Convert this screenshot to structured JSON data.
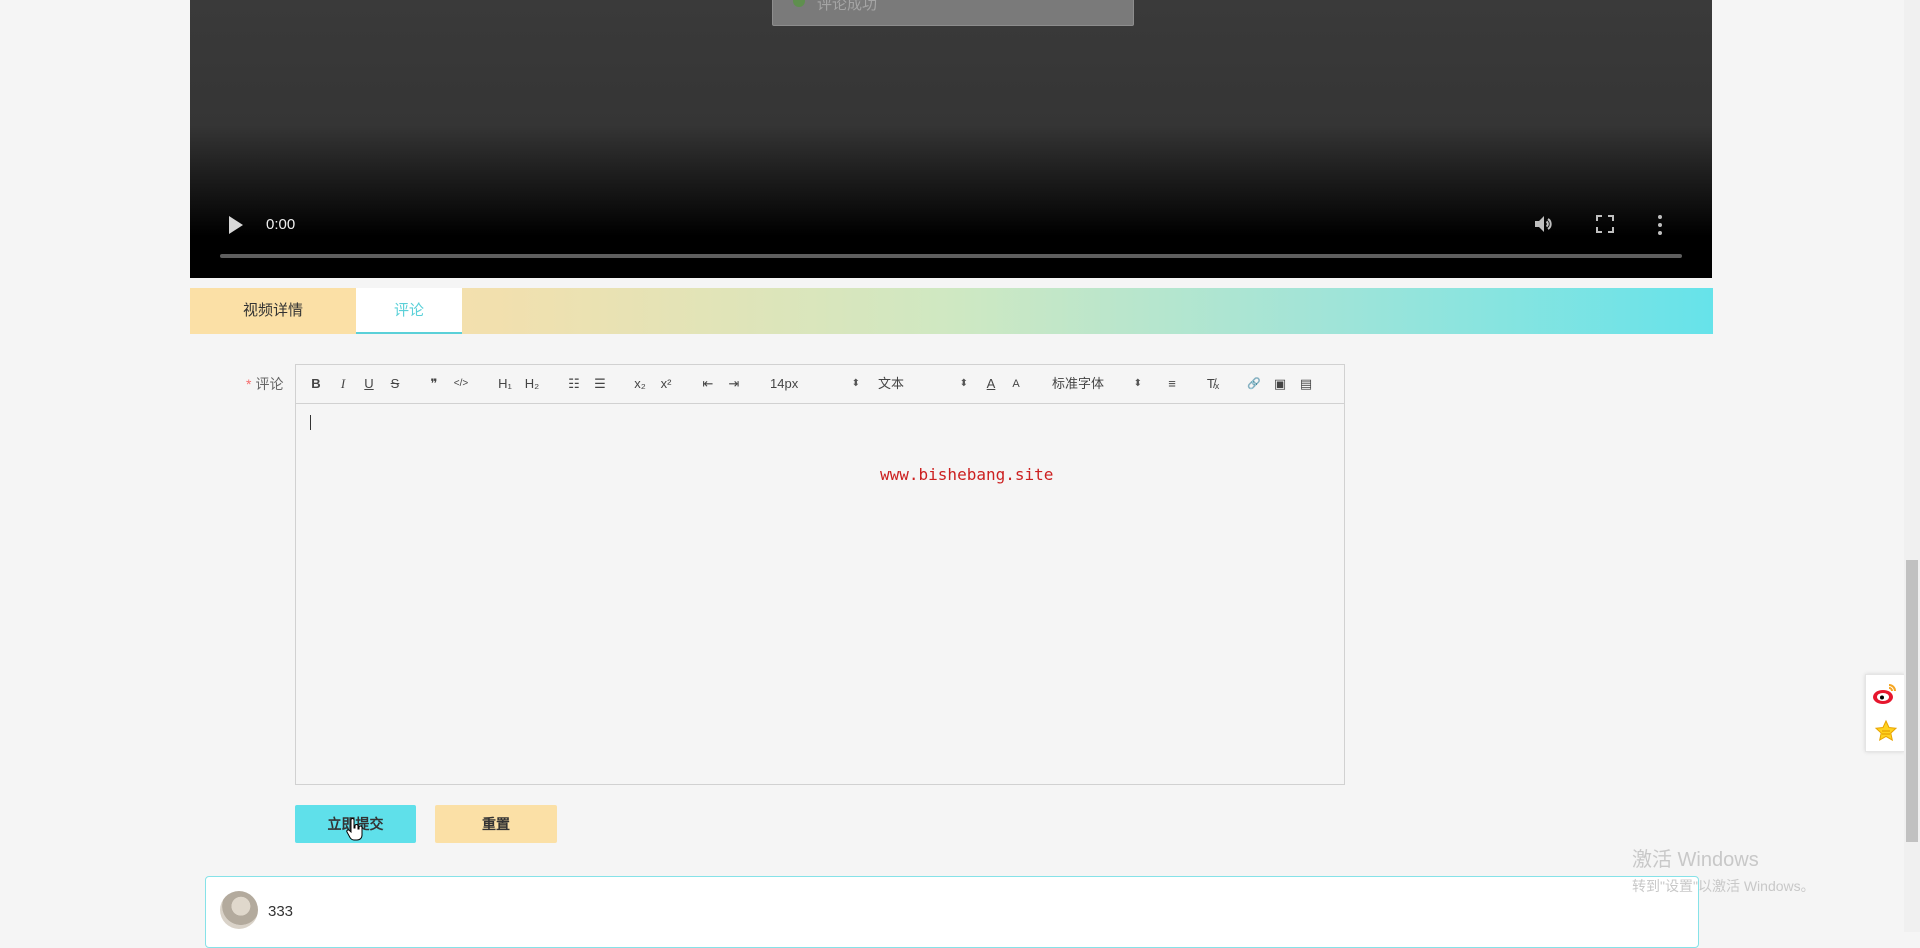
{
  "video": {
    "toast_text": "评论成功",
    "time": "0:00",
    "progress": 0
  },
  "tabs": [
    {
      "label": "视频详情",
      "active": false
    },
    {
      "label": "评论",
      "active": true
    }
  ],
  "form": {
    "label": "评论",
    "required_mark": "*",
    "editor": {
      "toolbar": {
        "bold": "B",
        "italic": "I",
        "underline": "U",
        "strike": "S",
        "blockquote": "❞",
        "code": "</>",
        "h1": "H₁",
        "h2": "H₂",
        "ordered_list": "☷",
        "bullet_list": "☰",
        "subscript": "x₂",
        "superscript": "x²",
        "outdent": "⇤",
        "indent": "⇥",
        "size_value": "14px",
        "header_value": "文本",
        "font_color": "A",
        "background_color": "A",
        "font_value": "标准字体",
        "align": "≡",
        "clean": "T̸ₓ",
        "link": "🔗",
        "image": "▣",
        "video": "▤"
      },
      "watermark": "www.bishebang.site",
      "content": ""
    },
    "submit_label": "立即提交",
    "reset_label": "重置"
  },
  "comments": [
    {
      "text": "333"
    }
  ],
  "system": {
    "activate_title": "激活 Windows",
    "activate_sub": "转到\"设置\"以激活 Windows。"
  },
  "colors": {
    "accent_cyan": "#5fe0ea",
    "accent_yellow": "#fbe0a6",
    "watermark_red": "#cc2020"
  }
}
